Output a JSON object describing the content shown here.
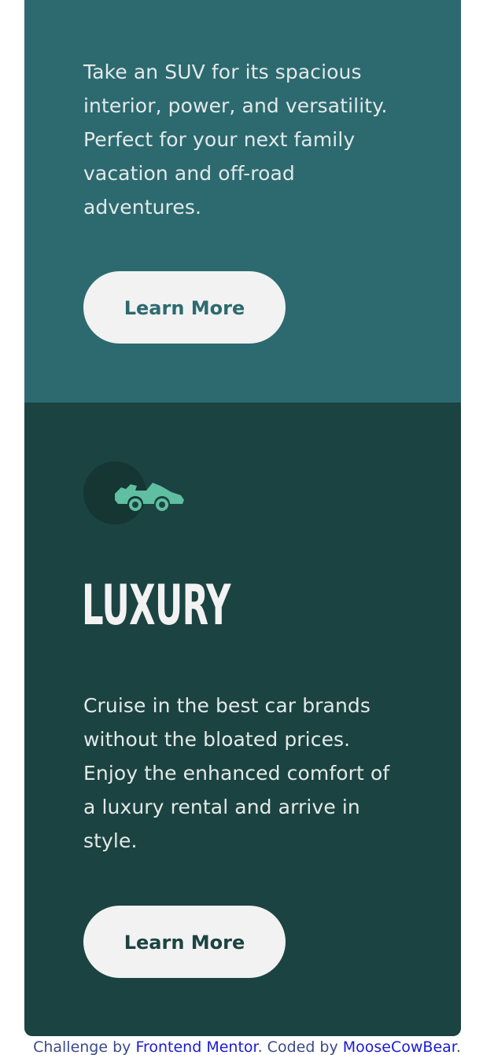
{
  "cards": {
    "suv": {
      "description": "Take an SUV for its spacious interior, power, and versatility. Perfect for your next family vacation and off-road adventures.",
      "button_label": "Learn More",
      "accent": "#2c6a70"
    },
    "luxury": {
      "icon": "luxury-car-icon",
      "heading": "LUXURY",
      "description": "Cruise in the best car brands without the bloated prices. Enjoy the enhanced comfort of a luxury rental and arrive in style.",
      "button_label": "Learn More",
      "accent": "#1b4341",
      "icon_color": "#5fbfa0"
    }
  },
  "attribution": {
    "prefix": "Challenge by ",
    "challenge_link": "Frontend Mentor",
    "middle": ". Coded by ",
    "author_link": "MooseCowBear",
    "suffix": "."
  }
}
